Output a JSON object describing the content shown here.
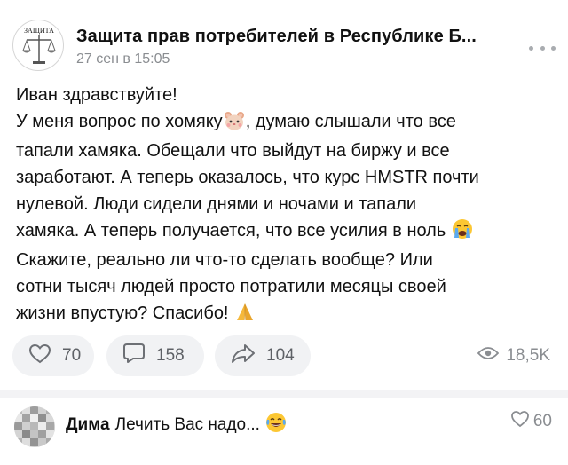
{
  "post": {
    "community_name": "Защита прав потребителей в Республике Б...",
    "date": "27 сен в 15:05",
    "avatar_text": "ЗАЩИТА",
    "text_lines": [
      "Иван здравствуйте!",
      "У меня вопрос по хомяку",
      ", думаю слышали что все",
      "тапали хамяка. Обещали что выйдут на биржу и все",
      "заработают. А теперь оказалось, что курс HMSTR почти",
      "нулевой. Люди сидели днями и ночами и тапали",
      "хамяка. А теперь получается, что все усилия в ноль",
      "Скажите, реально ли что-то сделать вообще? Или",
      "сотни тысяч людей просто потратили месяцы своей",
      "жизни впустую? Спасибо!"
    ],
    "emojis": [
      "hamster-face",
      "crying-face",
      "folded-hands"
    ]
  },
  "actions": {
    "likes": "70",
    "comments": "158",
    "shares": "104",
    "views": "18,5K"
  },
  "comment": {
    "author": "Дима",
    "text": "Лечить Вас надо...",
    "emoji": "face-with-tears-of-joy",
    "likes": "60"
  },
  "icons": [
    "more-dots-icon",
    "heart-icon",
    "comment-icon",
    "share-arrow-icon",
    "eye-icon",
    "heart-outline-icon"
  ],
  "colors": {
    "text": "#111111",
    "muted": "#8a8d91",
    "pill_bg": "#f1f2f4",
    "divider": "#f3f3f5"
  }
}
